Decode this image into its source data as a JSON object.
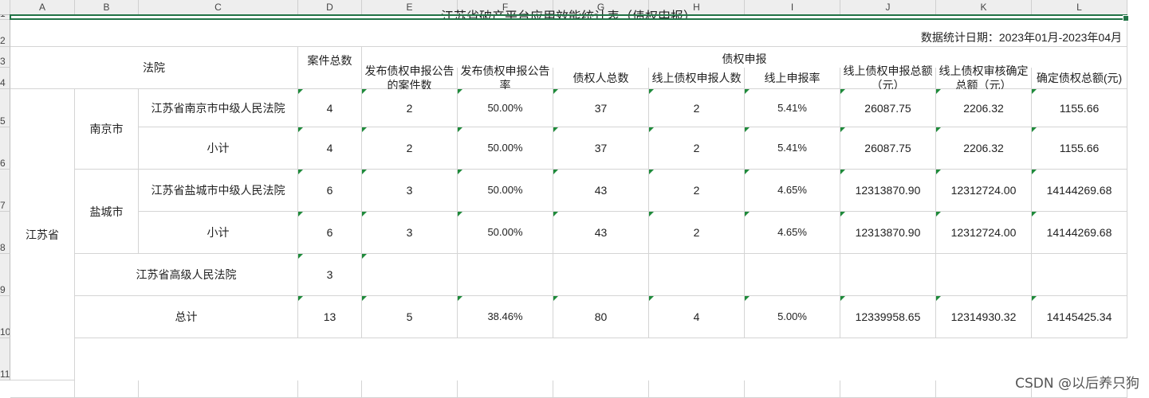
{
  "columns": [
    "A",
    "B",
    "C",
    "D",
    "E",
    "F",
    "G",
    "H",
    "I",
    "J",
    "K",
    "L"
  ],
  "rows": [
    "1",
    "2",
    "3",
    "4",
    "5",
    "6",
    "7",
    "8",
    "9",
    "10",
    "11"
  ],
  "title": "江苏省破产平台应用效能统计表（债权申报）",
  "date_note": "数据统计日期：2023年01月-2023年04月",
  "headers": {
    "court": "法院",
    "case_total": "案件总数",
    "group": "债权申报",
    "announced_cases": "发布债权申报公告的案件数",
    "announce_rate": "发布债权申报公告率",
    "creditors": "债权人总数",
    "online_creditors": "线上债权申报人数",
    "online_rate": "线上申报率",
    "online_amount": "线上债权申报总额（元）",
    "online_review": "线上债权审核确定总额（元）",
    "confirmed_total": "确定债权总额(元)"
  },
  "province": "江苏省",
  "cities": {
    "nanjing": "南京市",
    "yancheng": "盐城市"
  },
  "table": [
    {
      "label": "江苏省南京市中级人民法院",
      "cases": "4",
      "announced": "2",
      "rate": "50.00%",
      "creditors": "37",
      "online": "2",
      "online_rate": "5.41%",
      "online_amount": "26087.75",
      "review": "2206.32",
      "confirmed": "1155.66"
    },
    {
      "label": "小计",
      "cases": "4",
      "announced": "2",
      "rate": "50.00%",
      "creditors": "37",
      "online": "2",
      "online_rate": "5.41%",
      "online_amount": "26087.75",
      "review": "2206.32",
      "confirmed": "1155.66"
    },
    {
      "label": "江苏省盐城市中级人民法院",
      "cases": "6",
      "announced": "3",
      "rate": "50.00%",
      "creditors": "43",
      "online": "2",
      "online_rate": "4.65%",
      "online_amount": "12313870.90",
      "review": "12312724.00",
      "confirmed": "14144269.68"
    },
    {
      "label": "小计",
      "cases": "6",
      "announced": "3",
      "rate": "50.00%",
      "creditors": "43",
      "online": "2",
      "online_rate": "4.65%",
      "online_amount": "12313870.90",
      "review": "12312724.00",
      "confirmed": "14144269.68"
    },
    {
      "label": "江苏省高级人民法院",
      "cases": "3",
      "announced": "",
      "rate": "",
      "creditors": "",
      "online": "",
      "online_rate": "",
      "online_amount": "",
      "review": "",
      "confirmed": ""
    },
    {
      "label": "总计",
      "cases": "13",
      "announced": "5",
      "rate": "38.46%",
      "creditors": "80",
      "online": "4",
      "online_rate": "5.00%",
      "online_amount": "12339958.65",
      "review": "12314930.32",
      "confirmed": "14145425.34"
    }
  ],
  "watermark": "CSDN @以后养只狗"
}
